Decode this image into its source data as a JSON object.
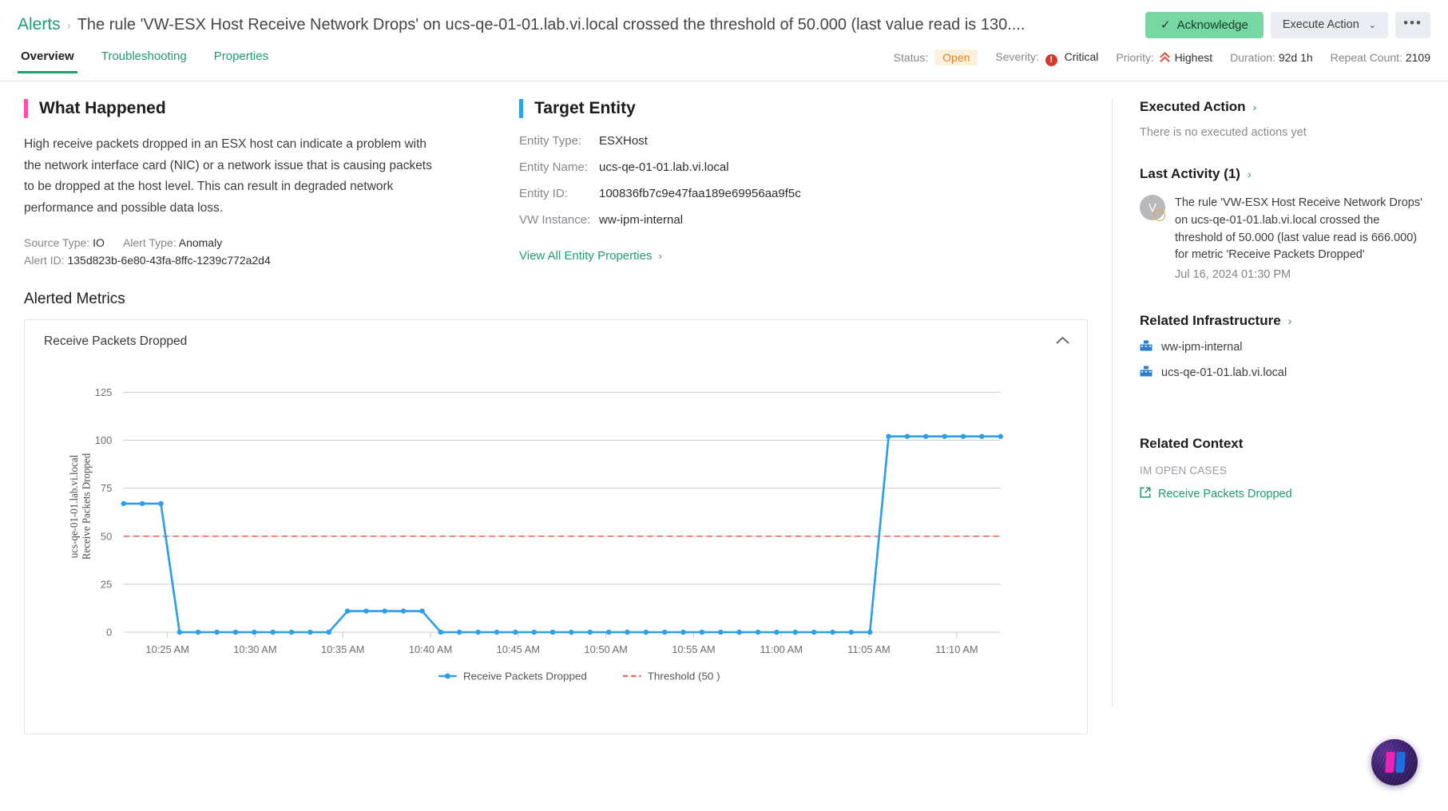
{
  "header": {
    "breadcrumb_root": "Alerts",
    "breadcrumb_sep": "›",
    "title": "The rule 'VW-ESX Host Receive Network Drops' on ucs-qe-01-01.lab.vi.local crossed the threshold of 50.000 (last value read is 130....",
    "acknowledge_label": "Acknowledge",
    "acknowledge_check": "✓",
    "execute_action_label": "Execute Action",
    "execute_action_caret": "⌄",
    "more_label": "•••",
    "accent_green": "#1f9e6e",
    "ack_green": "#78d6a4"
  },
  "tabs": [
    {
      "label": "Overview",
      "active": true
    },
    {
      "label": "Troubleshooting",
      "active": false
    },
    {
      "label": "Properties",
      "active": false
    }
  ],
  "meta": {
    "status_label": "Status:",
    "status_value": "Open",
    "severity_label": "Severity:",
    "severity_value": "Critical",
    "severity_glyph": "!",
    "priority_label": "Priority:",
    "priority_value": "Highest",
    "priority_glyph": "≫",
    "duration_label": "Duration:",
    "duration_value": "92d 1h",
    "repeat_label": "Repeat Count:",
    "repeat_value": "2109",
    "status_color": "#e08423",
    "critical_color": "#d9382c"
  },
  "what_happened": {
    "title": "What Happened",
    "body": "High receive packets dropped in an ESX host can indicate a problem with the network interface card (NIC) or a network issue that is causing packets to be dropped at the host level. This can result in degraded network performance and possible data loss.",
    "source_type_label": "Source Type:",
    "source_type_value": "IO",
    "alert_type_label": "Alert Type:",
    "alert_type_value": "Anomaly",
    "alert_id_label": "Alert ID:",
    "alert_id_value": "135d823b-6e80-43fa-8ffc-1239c772a2d4",
    "accent": "#ff4fa3"
  },
  "target_entity": {
    "title": "Target Entity",
    "accent": "#2aa3e8",
    "rows": [
      {
        "key": "Entity Type:",
        "value": "ESXHost"
      },
      {
        "key": "Entity Name:",
        "value": "ucs-qe-01-01.lab.vi.local"
      },
      {
        "key": "Entity ID:",
        "value": "100836fb7c9e47faa189e69956aa9f5c"
      },
      {
        "key": "VW Instance:",
        "value": "ww-ipm-internal"
      }
    ],
    "view_all_label": "View All Entity Properties",
    "view_all_chevron": "›"
  },
  "alerted_metrics": {
    "section_title": "Alerted Metrics",
    "card_title": "Receive Packets Dropped",
    "collapse_glyph": "⌃"
  },
  "sidebar": {
    "executed_action": {
      "title": "Executed Action",
      "chevron": "›",
      "empty_text": "There is no executed actions yet"
    },
    "last_activity": {
      "title": "Last Activity (1)",
      "chevron": "›",
      "avatar_initial": "V",
      "text": "The rule 'VW-ESX Host Receive Network Drops' on ucs-qe-01-01.lab.vi.local crossed the threshold of 50.000 (last value read is 666.000) for metric 'Receive Packets Dropped'",
      "timestamp": "Jul 16, 2024 01:30 PM"
    },
    "related_infrastructure": {
      "title": "Related Infrastructure",
      "chevron": "›",
      "items": [
        {
          "label": "ww-ipm-internal",
          "icon": "server-rack-icon"
        },
        {
          "label": "ucs-qe-01-01.lab.vi.local",
          "icon": "server-rack-icon"
        }
      ]
    },
    "related_context": {
      "title": "Related Context",
      "group_label": "IM OPEN CASES",
      "link_label": "Receive Packets Dropped",
      "link_icon": "external-link-icon"
    }
  },
  "fab": {
    "name": "assistant-widget-button"
  },
  "chart_data": {
    "type": "line",
    "title": "Receive Packets Dropped",
    "xlabel": "",
    "ylabel": "ucs-qe-01-01.lab.vi.local\nReceive Packets Dropped",
    "ylim": [
      0,
      131
    ],
    "yticks": [
      0,
      25,
      50,
      75,
      100,
      125
    ],
    "ytick_labels": [
      "0",
      "25",
      "50",
      "75",
      "100",
      "125"
    ],
    "xtick_labels": [
      "10:25 AM",
      "10:30 AM",
      "10:35 AM",
      "10:40 AM",
      "10:45 AM",
      "10:50 AM",
      "10:55 AM",
      "11:00 AM",
      "11:05 AM",
      "11:10 AM"
    ],
    "grid": true,
    "legend_position": "bottom",
    "series": [
      {
        "name": "Receive Packets Dropped",
        "color": "#2e9fe6",
        "style": "solid-with-markers",
        "x": [
          "10:23",
          "10:24",
          "10:25",
          "10:26",
          "10:27",
          "10:28",
          "10:29",
          "10:30",
          "10:31",
          "10:32",
          "10:33",
          "10:34",
          "10:35",
          "10:36",
          "10:37",
          "10:38",
          "10:39",
          "10:40",
          "10:41",
          "10:42",
          "10:43",
          "10:44",
          "10:45",
          "10:46",
          "10:47",
          "10:48",
          "10:49",
          "10:50",
          "10:51",
          "10:52",
          "10:53",
          "10:54",
          "10:55",
          "10:56",
          "10:57",
          "10:58",
          "10:59",
          "11:00",
          "11:01",
          "11:02",
          "11:03",
          "11:04",
          "11:05",
          "11:06",
          "11:07",
          "11:08",
          "11:09",
          "11:10"
        ],
        "values": [
          67,
          67,
          67,
          0,
          0,
          0,
          0,
          0,
          0,
          0,
          0,
          0,
          11,
          11,
          11,
          11,
          11,
          0,
          0,
          0,
          0,
          0,
          0,
          0,
          0,
          0,
          0,
          0,
          0,
          0,
          0,
          0,
          0,
          0,
          0,
          0,
          0,
          0,
          0,
          0,
          0,
          102,
          102,
          102,
          102,
          102,
          102,
          102
        ]
      }
    ],
    "threshold": {
      "name": "Threshold (50 )",
      "value": 50,
      "color": "#ef6a5e",
      "style": "dashed"
    },
    "legend": [
      {
        "label": "Receive Packets Dropped",
        "color": "#2e9fe6",
        "style": "solid"
      },
      {
        "label": "Threshold (50 )",
        "color": "#ef6a5e",
        "style": "dashed"
      }
    ]
  }
}
